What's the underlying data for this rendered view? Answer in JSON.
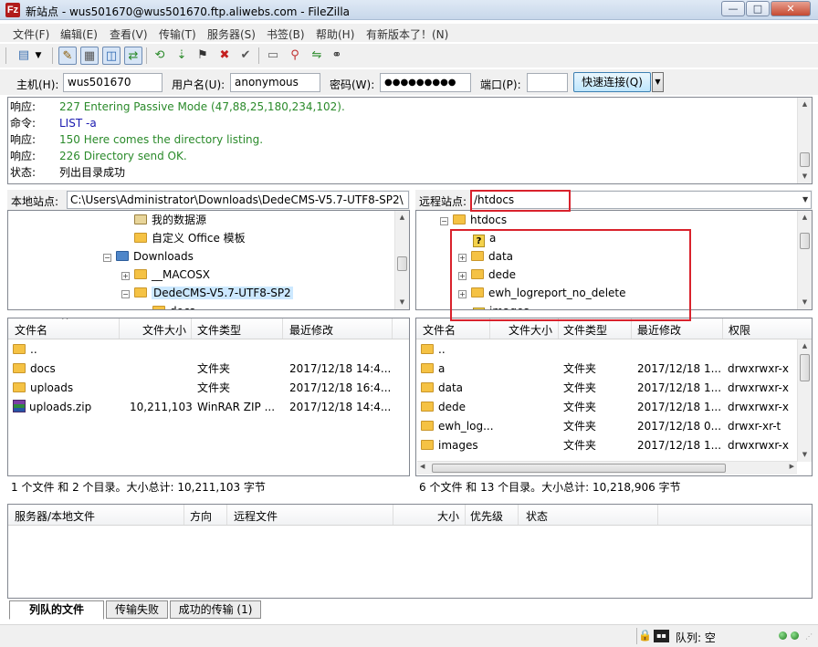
{
  "window": {
    "title": "新站点 - wus501670@wus501670.ftp.aliwebs.com - FileZilla",
    "app_icon": "Fz",
    "min_glyph": "—",
    "max_glyph": "□",
    "close_glyph": "✕"
  },
  "menu": [
    "文件(F)",
    "编辑(E)",
    "查看(V)",
    "传输(T)",
    "服务器(S)",
    "书签(B)",
    "帮助(H)",
    "有新版本了！(N)"
  ],
  "toolbar": {
    "icons": [
      "site-manager-icon",
      "dropdown-arrow-icon",
      "toggle-log-icon",
      "toggle-local-tree-icon",
      "toggle-remote-tree-icon",
      "toggle-queue-icon",
      "refresh-icon",
      "process-queue-icon",
      "cancel-icon",
      "disconnect-icon",
      "reconnect-icon",
      "open-filter-icon",
      "toggle-compare-icon",
      "sync-browse-icon",
      "search-icon"
    ]
  },
  "quickconnect": {
    "host_label": "主机(H):",
    "host_value": "wus501670",
    "user_label": "用户名(U):",
    "user_value": "anonymous",
    "pass_label": "密码(W):",
    "pass_value": "●●●●●●●●●",
    "port_label": "端口(P):",
    "port_value": "",
    "connect_label": "快速连接(Q)",
    "dropdown_glyph": "▼"
  },
  "log": [
    {
      "type": "响应:",
      "text": "227 Entering Passive Mode (47,88,25,180,234,102).",
      "color": "#2a8a2a"
    },
    {
      "type": "命令:",
      "text": "LIST -a",
      "color": "#1a1ab0"
    },
    {
      "type": "响应:",
      "text": "150 Here comes the directory listing.",
      "color": "#2a8a2a"
    },
    {
      "type": "响应:",
      "text": "226 Directory send OK.",
      "color": "#2a8a2a"
    },
    {
      "type": "状态:",
      "text": "列出目录成功",
      "color": "#000000"
    }
  ],
  "local": {
    "site_label": "本地站点:",
    "path": "C:\\Users\\Administrator\\Downloads\\DedeCMS-V5.7-UTF8-SP2\\",
    "tree": [
      {
        "label": "我的数据源",
        "icon": "database-folder-icon"
      },
      {
        "label": "自定义 Office 模板",
        "icon": "folder-icon"
      },
      {
        "label": "Downloads",
        "icon": "downloads-folder-icon",
        "expander": "−"
      },
      {
        "label": "__MACOSX",
        "icon": "folder-icon",
        "expander": "+"
      },
      {
        "label": "DedeCMS-V5.7-UTF8-SP2",
        "icon": "folder-icon",
        "expander": "−",
        "selected": true
      },
      {
        "label": "docs",
        "icon": "folder-icon"
      }
    ],
    "columns": [
      "文件名",
      "文件大小",
      "文件类型",
      "最近修改"
    ],
    "sort_glyph": "^",
    "files": [
      {
        "name": "..",
        "size": "",
        "type": "",
        "modified": "",
        "icon": "folder-icon"
      },
      {
        "name": "docs",
        "size": "",
        "type": "文件夹",
        "modified": "2017/12/18 14:4...",
        "icon": "folder-icon"
      },
      {
        "name": "uploads",
        "size": "",
        "type": "文件夹",
        "modified": "2017/12/18 16:4...",
        "icon": "folder-icon"
      },
      {
        "name": "uploads.zip",
        "size": "10,211,103",
        "type": "WinRAR ZIP ...",
        "modified": "2017/12/18 14:4...",
        "icon": "zip-archive-icon"
      }
    ],
    "status": "1 个文件 和 2 个目录。大小总计: 10,211,103 字节"
  },
  "remote": {
    "site_label": "远程站点:",
    "path": "/htdocs",
    "tree": [
      {
        "label": "htdocs",
        "icon": "folder-icon",
        "expander": "−"
      },
      {
        "label": "a",
        "icon": "unknown-folder-icon"
      },
      {
        "label": "data",
        "icon": "folder-icon",
        "expander": "+"
      },
      {
        "label": "dede",
        "icon": "folder-icon",
        "expander": "+"
      },
      {
        "label": "ewh_logreport_no_delete",
        "icon": "folder-icon",
        "expander": "+"
      },
      {
        "label": "images",
        "icon": "unknown-folder-icon"
      }
    ],
    "columns": [
      "文件名",
      "文件大小",
      "文件类型",
      "最近修改",
      "权限"
    ],
    "files": [
      {
        "name": "..",
        "type": "",
        "modified": "",
        "perm": ""
      },
      {
        "name": "a",
        "type": "文件夹",
        "modified": "2017/12/18 1...",
        "perm": "drwxrwxr-x"
      },
      {
        "name": "data",
        "type": "文件夹",
        "modified": "2017/12/18 1...",
        "perm": "drwxrwxr-x"
      },
      {
        "name": "dede",
        "type": "文件夹",
        "modified": "2017/12/18 1...",
        "perm": "drwxrwxr-x"
      },
      {
        "name": "ewh_log...",
        "type": "文件夹",
        "modified": "2017/12/18 0...",
        "perm": "drwxr-xr-t"
      },
      {
        "name": "images",
        "type": "文件夹",
        "modified": "2017/12/18 1...",
        "perm": "drwxrwxr-x"
      }
    ],
    "status": "6 个文件 和 13 个目录。大小总计: 10,218,906 字节"
  },
  "queue": {
    "columns": [
      "服务器/本地文件",
      "方向",
      "远程文件",
      "大小",
      "优先级",
      "状态"
    ],
    "tabs": [
      "列队的文件",
      "传输失败",
      "成功的传输 (1)"
    ]
  },
  "statusbar": {
    "queue_label": "队列: 空",
    "icons": [
      "lock-icon",
      "binary-mode-icon",
      "activity-led-icon",
      "activity-led-icon"
    ]
  },
  "colors": {
    "highlight_box": "#d9222c",
    "accent": "#3c7fb1",
    "selected_bg": "#cce8ff"
  }
}
